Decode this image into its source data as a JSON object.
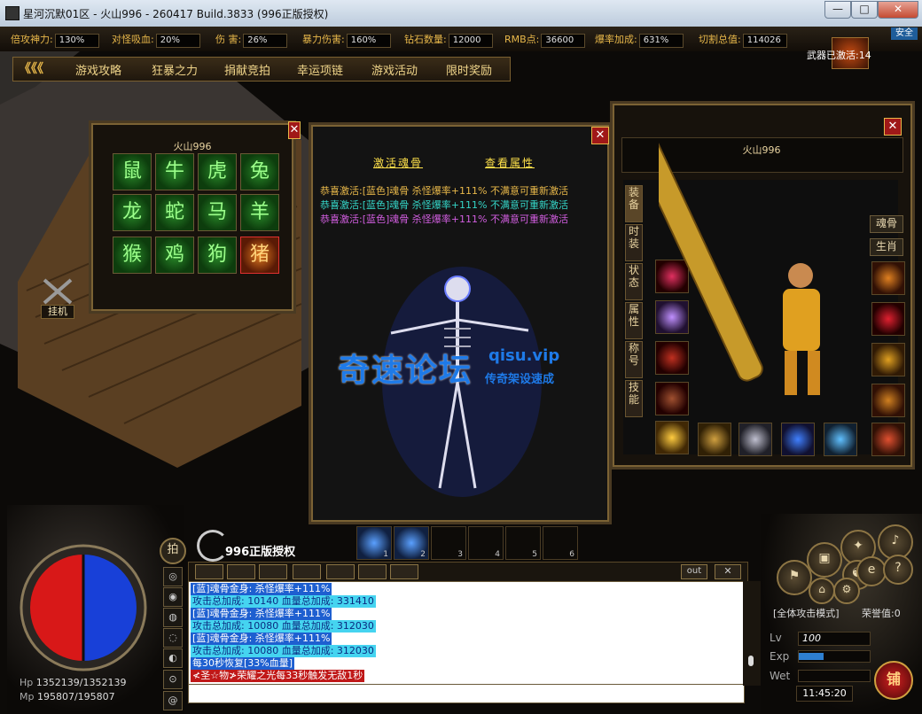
{
  "window": {
    "title": "星河沉默01区 - 火山996 - 260417 Build.3833 (996正版授权)",
    "close": "✕",
    "max": "□",
    "min": "—"
  },
  "stats": [
    {
      "label": "倍攻神力:",
      "value": "130%"
    },
    {
      "label": "对怪吸血:",
      "value": "20%"
    },
    {
      "label": "伤 害:",
      "value": "26%"
    },
    {
      "label": "暴力伤害:",
      "value": "160%"
    },
    {
      "label": "钻石数量:",
      "value": "12000"
    },
    {
      "label": "RMB点:",
      "value": "36600"
    },
    {
      "label": "爆率加成:",
      "value": "631%"
    },
    {
      "label": "切割总值:",
      "value": "114026"
    }
  ],
  "safe_badge": "安全",
  "weapon_activate": {
    "text": "武器已激活",
    "count": ":14"
  },
  "menu": {
    "arrows": "《《《",
    "items": [
      "游戏攻略",
      "狂暴之力",
      "捐献竞拍",
      "幸运项链",
      "游戏活动",
      "限时奖励"
    ]
  },
  "guaji": "挂机",
  "zodiac_panel": {
    "title": "火山996",
    "tiles": [
      "鼠",
      "牛",
      "虎",
      "兔",
      "龙",
      "蛇",
      "马",
      "羊",
      "猴",
      "鸡",
      "狗",
      "猪"
    ]
  },
  "soul_panel": {
    "tabs": [
      "激活魂骨",
      "查看属性"
    ],
    "lines": [
      {
        "text": "恭喜激活:[蓝色]魂骨 杀怪爆率+111%  不满意可重新激活",
        "color": "#e8b84a"
      },
      {
        "text": "恭喜激活:[蓝色]魂骨 杀怪爆率+111%  不满意可重新激活",
        "color": "#35d6c8"
      },
      {
        "text": "恭喜激活:[蓝色]魂骨 杀怪爆率+111%  不满意可重新激活",
        "color": "#d25ee0"
      }
    ],
    "watermark": {
      "main": "奇速论坛",
      "site": "qisu.vip",
      "sub": "传奇架设速成"
    }
  },
  "equip_panel": {
    "name": "火山996",
    "side_tabs": [
      "装备",
      "时装",
      "状态",
      "属性",
      "称号",
      "技能"
    ],
    "buttons": [
      "魂骨",
      "生肖"
    ]
  },
  "logo": {
    "text": "996正版授权"
  },
  "pai": "拍",
  "hotbar": [
    "1",
    "2",
    "3",
    "4",
    "5",
    "6"
  ],
  "chat_toolbar": {
    "out": "out",
    "close": "✕"
  },
  "chat": [
    {
      "text": "[蓝]魂骨金身: 杀怪爆率+111%",
      "bg": "#1e5fd0",
      "fg": "#ffffff"
    },
    {
      "text": "攻击总加成: 10140    血量总加成: 331410",
      "bg": "#45d4f0",
      "fg": "#0a2a80"
    },
    {
      "text": "[蓝]魂骨金身: 杀怪爆率+111%",
      "bg": "#1e5fd0",
      "fg": "#ffffff"
    },
    {
      "text": "攻击总加成: 10080    血量总加成: 312030",
      "bg": "#45d4f0",
      "fg": "#0a2a80"
    },
    {
      "text": "[蓝]魂骨金身: 杀怪爆率+111%",
      "bg": "#1e5fd0",
      "fg": "#ffffff"
    },
    {
      "text": "攻击总加成: 10080    血量总加成: 312030",
      "bg": "#45d4f0",
      "fg": "#0a2a80"
    },
    {
      "text": "每30秒恢复[33%血量]",
      "bg": "#1e5fd0",
      "fg": "#ffffff"
    },
    {
      "text": "≮圣☆物≯荣耀之光每33秒触发无敌1秒",
      "bg": "#c01818",
      "fg": "#ffffff"
    }
  ],
  "hp": {
    "label": "Hp",
    "value": "1352139/1352139"
  },
  "mp": {
    "label": "Mp",
    "value": "195807/195807"
  },
  "attack_mode": "[全体攻击模式]",
  "honor": "荣誉值:0",
  "level": {
    "label": "Lv",
    "value": "100"
  },
  "exp": {
    "label": "Exp",
    "progress": 0.35
  },
  "weight": {
    "label": "Wet"
  },
  "clock": "11:45:20",
  "shop": "铺"
}
